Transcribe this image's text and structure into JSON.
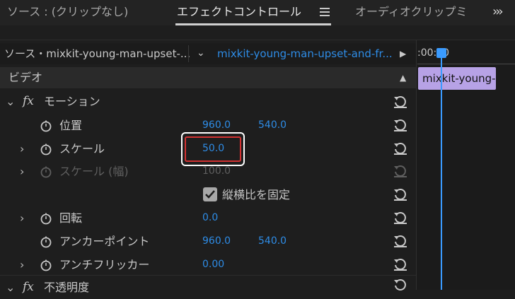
{
  "tabs": [
    {
      "label": "ソース : (クリップなし)"
    },
    {
      "label": "エフェクトコントロール"
    },
    {
      "label": "オーディオクリップミ"
    }
  ],
  "source": {
    "left": "ソース・mixkit-young-man-upset-...",
    "right": "mixkit-young-man-upset-and-fr..."
  },
  "timeline": {
    "timecode": ":00:00",
    "clip_label": "mixkit-young-m"
  },
  "section_video": "ビデオ",
  "motion": {
    "title": "モーション",
    "fx_label": "fx",
    "rows": [
      {
        "label": "位置",
        "v1": "960.0",
        "v2": "540.0"
      },
      {
        "label": "スケール",
        "v1": "50.0"
      },
      {
        "label": "スケール (幅)",
        "v1": "100.0"
      },
      {
        "label": "縦横比を固定"
      },
      {
        "label": "回転",
        "v1": "0.0"
      },
      {
        "label": "アンカーポイント",
        "v1": "960.0",
        "v2": "540.0"
      },
      {
        "label": "アンチフリッカー",
        "v1": "0.00"
      }
    ]
  },
  "opacity_title": "不透明度",
  "colors": {
    "accent": "#2e8ce6",
    "playhead": "#3a9bff",
    "clip": "#b7a2e6",
    "highlight": "#d23232"
  }
}
